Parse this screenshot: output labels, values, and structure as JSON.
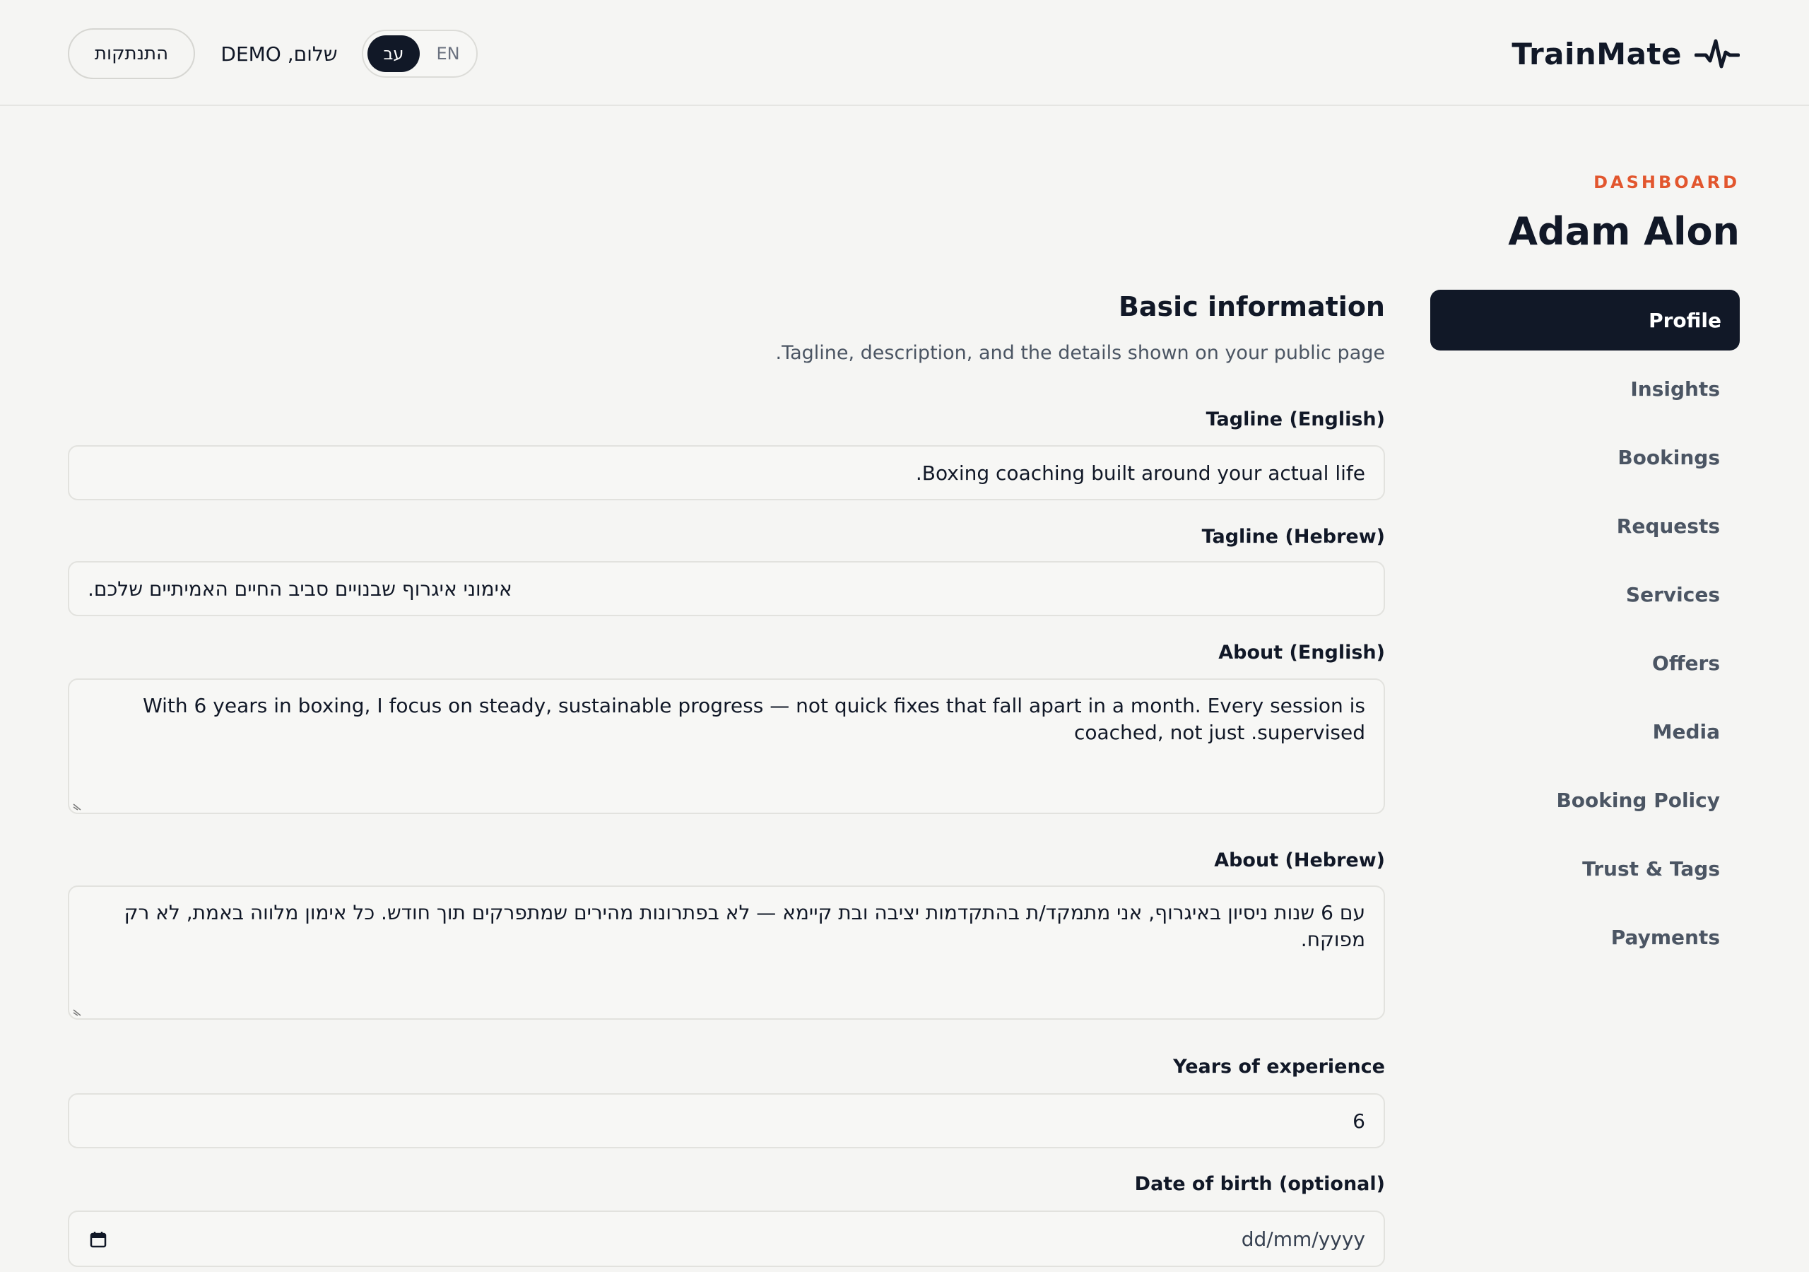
{
  "header": {
    "brand": "TrainMate",
    "brand_icon": "pulse-icon",
    "greeting": "שלום, DEMO",
    "logout_label": "התנתקות",
    "lang_he": "עב",
    "lang_en": "EN",
    "active_lang": "he"
  },
  "sidebar": {
    "section_label": "DASHBOARD",
    "trainer_name": "Adam Alon",
    "items": [
      {
        "label": "Profile",
        "active": true
      },
      {
        "label": "Insights"
      },
      {
        "label": "Bookings"
      },
      {
        "label": "Requests"
      },
      {
        "label": "Services"
      },
      {
        "label": "Offers"
      },
      {
        "label": "Media"
      },
      {
        "label": "Booking Policy"
      },
      {
        "label": "Trust & Tags"
      },
      {
        "label": "Payments"
      }
    ]
  },
  "main": {
    "title": "Basic information",
    "subtitle": ".Tagline, description, and the details shown on your public page",
    "fields": {
      "tagline_en": {
        "label": "Tagline (English)",
        "value": ".Boxing coaching built around your actual life"
      },
      "tagline_he": {
        "label": "Tagline (Hebrew)",
        "value": "אימוני איגרוף שבנויים סביב החיים האמיתיים שלכם."
      },
      "about_en": {
        "label": "About (English)",
        "value": "With 6 years in boxing, I focus on steady, sustainable progress — not quick fixes that fall apart in a month. Every session is coached, not just .supervised"
      },
      "about_he": {
        "label": "About (Hebrew)",
        "value": "עם 6 שנות ניסיון באיגרוף, אני מתמקד/ת בהתקדמות יציבה ובת קיימא — לא בפתרונות מהירים שמתפרקים תוך חודש. כל אימון מלווה באמת, לא רק מפוקח."
      },
      "years": {
        "label": "Years of experience",
        "value": "6"
      },
      "dob": {
        "label": "Date of birth (optional)",
        "placeholder": "dd/mm/yyyy"
      }
    }
  },
  "colors": {
    "accent": "#e2562e",
    "dark": "#111827",
    "background": "#f5f5f3"
  }
}
